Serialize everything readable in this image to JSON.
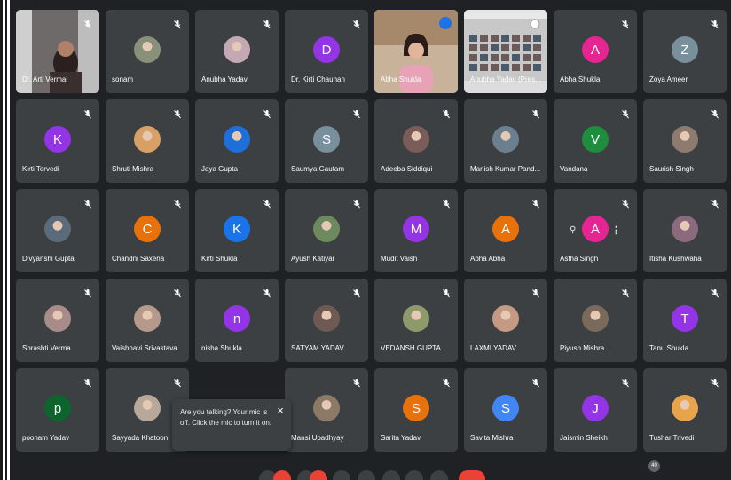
{
  "participants": [
    {
      "name": "Dr. Arti Vermai",
      "avatar_type": "video",
      "speaking": false
    },
    {
      "name": "sonam",
      "avatar_type": "photo",
      "photo_color": "#8a8f7a"
    },
    {
      "name": "Anubha Yadav",
      "avatar_type": "photo",
      "photo_color": "#c4a9b4"
    },
    {
      "name": "Dr. Kirti Chauhan",
      "avatar_type": "letter",
      "letter": "D",
      "color": "#9334e6"
    },
    {
      "name": "Abha Shukla",
      "avatar_type": "video-speaking",
      "speaking": true
    },
    {
      "name": "Anubha Yadav (Pres...",
      "avatar_type": "presentation"
    },
    {
      "name": "Abha Shukla",
      "avatar_type": "letter",
      "letter": "A",
      "color": "#e52592"
    },
    {
      "name": "Zoya Ameer",
      "avatar_type": "letter",
      "letter": "Z",
      "color": "#78909c"
    },
    {
      "name": "Kirti Tervedi",
      "avatar_type": "letter",
      "letter": "K",
      "color": "#9334e6"
    },
    {
      "name": "Shruti Mishra",
      "avatar_type": "photo",
      "photo_color": "#d9a066"
    },
    {
      "name": "Jaya Gupta",
      "avatar_type": "photo",
      "photo_color": "#1e6fd9"
    },
    {
      "name": "Saumya Gautam",
      "avatar_type": "letter",
      "letter": "S",
      "color": "#78909c"
    },
    {
      "name": "Adeeba Siddiqui",
      "avatar_type": "photo",
      "photo_color": "#7a5c58"
    },
    {
      "name": "Manish Kumar Pand...",
      "avatar_type": "photo",
      "photo_color": "#6b7f8e"
    },
    {
      "name": "Vandana",
      "avatar_type": "letter",
      "letter": "V",
      "color": "#1e8e3e"
    },
    {
      "name": "Saurish Singh",
      "avatar_type": "photo",
      "photo_color": "#8c7b6e"
    },
    {
      "name": "Divyanshi Gupta",
      "avatar_type": "photo",
      "photo_color": "#5c6b7a"
    },
    {
      "name": "Chandni Saxena",
      "avatar_type": "letter",
      "letter": "C",
      "color": "#e8710a"
    },
    {
      "name": "Kirti Shukla",
      "avatar_type": "letter",
      "letter": "K",
      "color": "#1a73e8"
    },
    {
      "name": "Ayush Katiyar",
      "avatar_type": "photo",
      "photo_color": "#6d8a5e"
    },
    {
      "name": "Mudit Vaish",
      "avatar_type": "letter",
      "letter": "M",
      "color": "#9334e6"
    },
    {
      "name": "Abha Abha",
      "avatar_type": "letter",
      "letter": "A",
      "color": "#e8710a"
    },
    {
      "name": "Astha Singh",
      "avatar_type": "letter",
      "letter": "A",
      "color": "#e52592",
      "hovered": true
    },
    {
      "name": "Itisha Kushwaha",
      "avatar_type": "photo",
      "photo_color": "#8a6a7c"
    },
    {
      "name": "Shrashti Verma",
      "avatar_type": "photo",
      "photo_color": "#a88c8a"
    },
    {
      "name": "Vaishnavi Srivastava",
      "avatar_type": "photo",
      "photo_color": "#b59a8c"
    },
    {
      "name": "nisha Shukla",
      "avatar_type": "letter",
      "letter": "n",
      "color": "#9334e6"
    },
    {
      "name": "SATYAM YADAV",
      "avatar_type": "photo",
      "photo_color": "#6e5a52"
    },
    {
      "name": "VEDANSH GUPTA",
      "avatar_type": "photo",
      "photo_color": "#8e9a6c"
    },
    {
      "name": "LAXMI YADAV",
      "avatar_type": "photo",
      "photo_color": "#c49a84"
    },
    {
      "name": "Piyush Mishra",
      "avatar_type": "photo",
      "photo_color": "#7a6a5c"
    },
    {
      "name": "Tanu Shukla",
      "avatar_type": "letter",
      "letter": "T",
      "color": "#9334e6"
    },
    {
      "name": "poonam Yadav",
      "avatar_type": "letter",
      "letter": "p",
      "color": "#0d652d"
    },
    {
      "name": "Sayyada Khatoon",
      "avatar_type": "photo",
      "photo_color": "#b8a89a"
    },
    {
      "name": "",
      "avatar_type": "hidden"
    },
    {
      "name": "Mansi Upadhyay",
      "avatar_type": "photo",
      "photo_color": "#8c7a66"
    },
    {
      "name": "Sarita Yadav",
      "avatar_type": "letter",
      "letter": "S",
      "color": "#e8710a"
    },
    {
      "name": "Savita Mishra",
      "avatar_type": "letter",
      "letter": "S",
      "color": "#4285f4"
    },
    {
      "name": "Jaismin Sheikh",
      "avatar_type": "letter",
      "letter": "J",
      "color": "#9334e6"
    },
    {
      "name": "Tushar Trivedi",
      "avatar_type": "photo",
      "photo_color": "#e8a44a"
    }
  ],
  "tooltip": {
    "text": "Are you talking? Your mic is off. Click the mic to turn it on.",
    "close": "×"
  },
  "toolbar": {
    "participant_count": "40"
  }
}
